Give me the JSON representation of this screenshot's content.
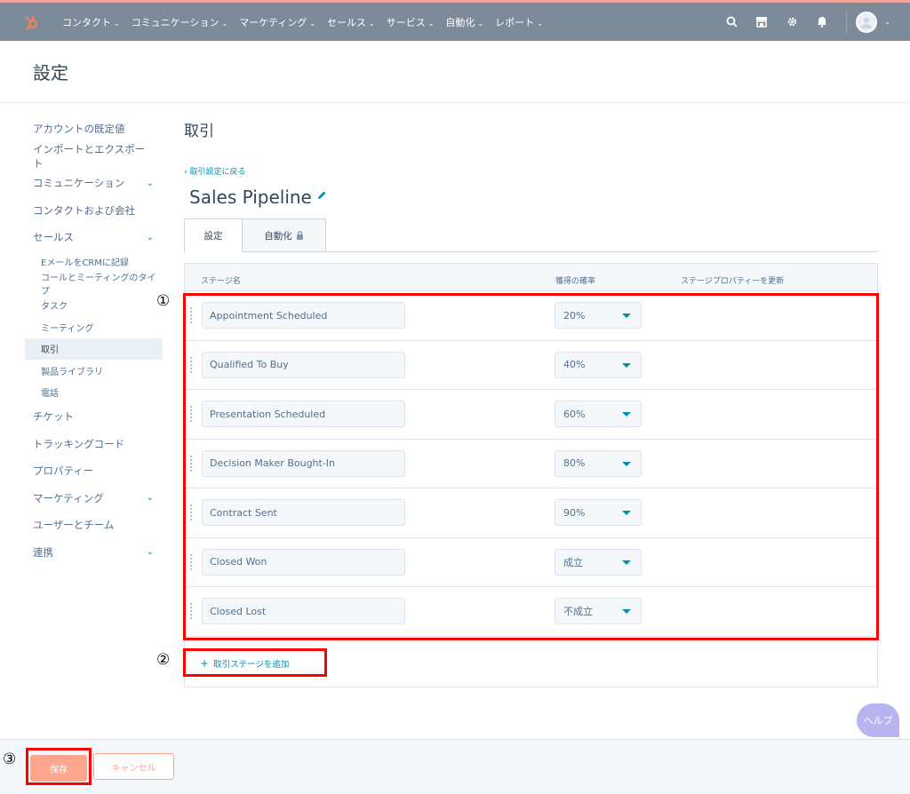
{
  "nav": {
    "items": [
      "コンタクト",
      "コミュニケーション",
      "マーケティング",
      "セールス",
      "サービス",
      "自動化",
      "レポート"
    ]
  },
  "page": {
    "title": "設定"
  },
  "sidebar": {
    "items": [
      {
        "label": "アカウントの既定値",
        "chevron": false
      },
      {
        "label": "インポートとエクスポート",
        "chevron": false
      },
      {
        "label": "コミュニケーション",
        "chevron": true
      },
      {
        "label": "コンタクトおよび会社",
        "chevron": false
      },
      {
        "label": "セールス",
        "chevron": true
      }
    ],
    "sub": [
      "EメールをCRMに記録",
      "コールとミーティングのタイプ",
      "タスク",
      "ミーティング",
      "取引",
      "製品ライブラリ",
      "電話"
    ],
    "items2": [
      {
        "label": "チケット",
        "chevron": false
      },
      {
        "label": "トラッキングコード",
        "chevron": false
      },
      {
        "label": "プロパティー",
        "chevron": false
      },
      {
        "label": "マーケティング",
        "chevron": true
      },
      {
        "label": "ユーザーとチーム",
        "chevron": false
      },
      {
        "label": "連携",
        "chevron": true
      }
    ],
    "active_sub": "取引"
  },
  "main": {
    "section_title": "取引",
    "back_link": "‹ 取引設定に戻る",
    "pipeline_name": "Sales Pipeline",
    "tabs": {
      "settings": "設定",
      "automation": "自動化"
    },
    "columns": {
      "stage": "ステージ名",
      "probability": "獲得の確率",
      "update": "ステージプロパティーを更新"
    },
    "stages": [
      {
        "name": "Appointment Scheduled",
        "prob": "20%"
      },
      {
        "name": "Qualified To Buy",
        "prob": "40%"
      },
      {
        "name": "Presentation Scheduled",
        "prob": "60%"
      },
      {
        "name": "Decision Maker Bought-In",
        "prob": "80%"
      },
      {
        "name": "Contract Sent",
        "prob": "90%"
      },
      {
        "name": "Closed Won",
        "prob": "成立"
      },
      {
        "name": "Closed Lost",
        "prob": "不成立"
      }
    ],
    "add_stage": "取引ステージを追加"
  },
  "annotations": {
    "one": "①",
    "two": "②",
    "three": "③"
  },
  "footer": {
    "save": "保存",
    "cancel": "キャンセル"
  },
  "help": "ヘルプ",
  "colors": {
    "accent": "#0091ae",
    "brand": "#ff7a59",
    "annotation": "#ff0000",
    "nav": "#7c8b9a"
  }
}
